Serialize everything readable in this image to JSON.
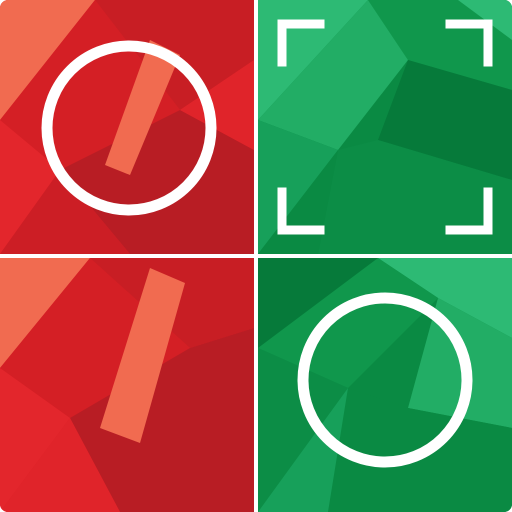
{
  "app_icon": {
    "layout": "2x2 tile grid",
    "colors": {
      "red_base": "#dc1f26",
      "red_dark": "#b81d24",
      "red_mid": "#e3262c",
      "red_light": "#f16b50",
      "green_base": "#0a8a43",
      "green_dark": "#067a3a",
      "green_mid": "#10974c",
      "green_light": "#2dba74",
      "symbol": "#ffffff"
    },
    "tiles": [
      {
        "position": "top-left",
        "color": "red",
        "symbol": "circle-outline"
      },
      {
        "position": "top-right",
        "color": "green",
        "symbol": "viewfinder-corners"
      },
      {
        "position": "bottom-left",
        "color": "red",
        "symbol": "none"
      },
      {
        "position": "bottom-right",
        "color": "green",
        "symbol": "circle-outline"
      }
    ]
  }
}
